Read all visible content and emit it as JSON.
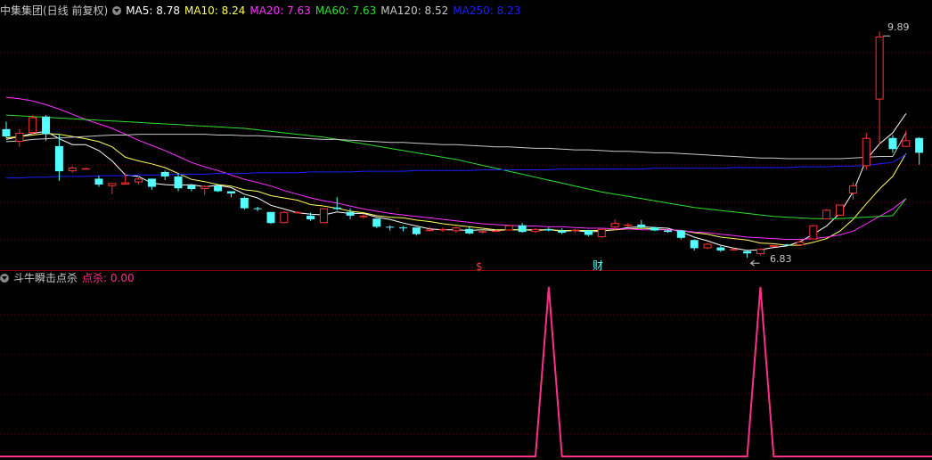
{
  "colors": {
    "background": "#000000",
    "up_candle": "#ff3232",
    "down_candle": "#54ffff",
    "grid": "#6e0000",
    "ma5": "#ffffff",
    "ma10": "#ffff5c",
    "ma20": "#ff32ff",
    "ma60": "#2ee02e",
    "ma120": "#c8c8c8",
    "ma250": "#1e1eff",
    "signal": "#ff2f8a"
  },
  "header": {
    "title": "中集集团(日线 前复权)",
    "indicators": [
      {
        "label": "MA5: 8.78",
        "color": "#ffffff"
      },
      {
        "label": "MA10: 8.24",
        "color": "#ffff5c"
      },
      {
        "label": "MA20: 7.63",
        "color": "#ff32ff"
      },
      {
        "label": "MA60: 7.63",
        "color": "#2ee02e"
      },
      {
        "label": "MA120: 8.52",
        "color": "#c8c8c8"
      },
      {
        "label": "MA250: 8.23",
        "color": "#1e1eff"
      }
    ]
  },
  "price_labels": {
    "high": "9.89",
    "low": "6.83"
  },
  "markers": {
    "dollar": "$",
    "caibao": "财"
  },
  "sub_chart": {
    "title": "斗牛瞬击点杀",
    "value_label": "点杀: 0.00"
  },
  "chart_data": {
    "type": "candlestick",
    "candles": [
      {
        "o": 8.57,
        "h": 8.67,
        "l": 8.45,
        "c": 8.47
      },
      {
        "o": 8.4,
        "h": 8.57,
        "l": 8.33,
        "c": 8.52
      },
      {
        "o": 8.52,
        "h": 8.76,
        "l": 8.5,
        "c": 8.73
      },
      {
        "o": 8.74,
        "h": 8.76,
        "l": 8.41,
        "c": 8.5
      },
      {
        "o": 8.34,
        "h": 8.5,
        "l": 7.87,
        "c": 8.0
      },
      {
        "o": 8.0,
        "h": 8.07,
        "l": 7.98,
        "c": 8.05
      },
      {
        "o": 8.03,
        "h": 8.05,
        "l": 8.03,
        "c": 8.04
      },
      {
        "o": 7.9,
        "h": 7.94,
        "l": 7.79,
        "c": 7.82
      },
      {
        "o": 7.8,
        "h": 7.84,
        "l": 7.69,
        "c": 7.84
      },
      {
        "o": 7.82,
        "h": 7.96,
        "l": 7.82,
        "c": 7.85
      },
      {
        "o": 7.85,
        "h": 7.94,
        "l": 7.82,
        "c": 7.9
      },
      {
        "o": 7.9,
        "h": 7.9,
        "l": 7.75,
        "c": 7.79
      },
      {
        "o": 7.99,
        "h": 8.01,
        "l": 7.88,
        "c": 7.93
      },
      {
        "o": 7.93,
        "h": 7.98,
        "l": 7.73,
        "c": 7.77
      },
      {
        "o": 7.81,
        "h": 7.82,
        "l": 7.73,
        "c": 7.76
      },
      {
        "o": 7.76,
        "h": 7.81,
        "l": 7.68,
        "c": 7.8
      },
      {
        "o": 7.8,
        "h": 7.82,
        "l": 7.72,
        "c": 7.73
      },
      {
        "o": 7.73,
        "h": 7.73,
        "l": 7.65,
        "c": 7.7
      },
      {
        "o": 7.64,
        "h": 7.66,
        "l": 7.48,
        "c": 7.5
      },
      {
        "o": 7.5,
        "h": 7.52,
        "l": 7.46,
        "c": 7.49
      },
      {
        "o": 7.45,
        "h": 7.45,
        "l": 7.29,
        "c": 7.3
      },
      {
        "o": 7.3,
        "h": 7.46,
        "l": 7.3,
        "c": 7.45
      },
      {
        "o": 7.44,
        "h": 7.46,
        "l": 7.43,
        "c": 7.45
      },
      {
        "o": 7.4,
        "h": 7.44,
        "l": 7.33,
        "c": 7.35
      },
      {
        "o": 7.3,
        "h": 7.5,
        "l": 7.3,
        "c": 7.5
      },
      {
        "o": 7.51,
        "h": 7.65,
        "l": 7.47,
        "c": 7.49
      },
      {
        "o": 7.45,
        "h": 7.5,
        "l": 7.35,
        "c": 7.4
      },
      {
        "o": 7.38,
        "h": 7.43,
        "l": 7.36,
        "c": 7.4
      },
      {
        "o": 7.36,
        "h": 7.36,
        "l": 7.23,
        "c": 7.25
      },
      {
        "o": 7.25,
        "h": 7.27,
        "l": 7.2,
        "c": 7.24
      },
      {
        "o": 7.24,
        "h": 7.26,
        "l": 7.19,
        "c": 7.23
      },
      {
        "o": 7.24,
        "h": 7.24,
        "l": 7.13,
        "c": 7.15
      },
      {
        "o": 7.2,
        "h": 7.25,
        "l": 7.19,
        "c": 7.21
      },
      {
        "o": 7.2,
        "h": 7.24,
        "l": 7.18,
        "c": 7.22
      },
      {
        "o": 7.19,
        "h": 7.25,
        "l": 7.17,
        "c": 7.24
      },
      {
        "o": 7.22,
        "h": 7.25,
        "l": 7.15,
        "c": 7.16
      },
      {
        "o": 7.18,
        "h": 7.21,
        "l": 7.16,
        "c": 7.19
      },
      {
        "o": 7.19,
        "h": 7.21,
        "l": 7.18,
        "c": 7.2
      },
      {
        "o": 7.2,
        "h": 7.27,
        "l": 7.2,
        "c": 7.27
      },
      {
        "o": 7.27,
        "h": 7.3,
        "l": 7.17,
        "c": 7.18
      },
      {
        "o": 7.18,
        "h": 7.23,
        "l": 7.17,
        "c": 7.22
      },
      {
        "o": 7.22,
        "h": 7.24,
        "l": 7.19,
        "c": 7.2
      },
      {
        "o": 7.2,
        "h": 7.23,
        "l": 7.15,
        "c": 7.17
      },
      {
        "o": 7.19,
        "h": 7.22,
        "l": 7.17,
        "c": 7.21
      },
      {
        "o": 7.2,
        "h": 7.21,
        "l": 7.12,
        "c": 7.14
      },
      {
        "o": 7.11,
        "h": 7.22,
        "l": 7.1,
        "c": 7.22
      },
      {
        "o": 7.24,
        "h": 7.35,
        "l": 7.2,
        "c": 7.3
      },
      {
        "o": 7.28,
        "h": 7.3,
        "l": 7.25,
        "c": 7.28
      },
      {
        "o": 7.28,
        "h": 7.34,
        "l": 7.22,
        "c": 7.24
      },
      {
        "o": 7.24,
        "h": 7.25,
        "l": 7.19,
        "c": 7.2
      },
      {
        "o": 7.2,
        "h": 7.22,
        "l": 7.17,
        "c": 7.18
      },
      {
        "o": 7.2,
        "h": 7.21,
        "l": 7.08,
        "c": 7.1
      },
      {
        "o": 7.07,
        "h": 7.08,
        "l": 6.93,
        "c": 6.96
      },
      {
        "o": 6.96,
        "h": 7.03,
        "l": 6.95,
        "c": 7.02
      },
      {
        "o": 6.97,
        "h": 6.99,
        "l": 6.91,
        "c": 6.93
      },
      {
        "o": 6.94,
        "h": 6.96,
        "l": 6.93,
        "c": 6.95
      },
      {
        "o": 6.92,
        "h": 6.93,
        "l": 6.83,
        "c": 6.89
      },
      {
        "o": 6.88,
        "h": 6.96,
        "l": 6.86,
        "c": 6.95
      },
      {
        "o": 6.98,
        "h": 7.0,
        "l": 6.98,
        "c": 7.0
      },
      {
        "o": 7.01,
        "h": 7.02,
        "l": 6.99,
        "c": 7.0
      },
      {
        "o": 7.0,
        "h": 7.06,
        "l": 7.0,
        "c": 7.05
      },
      {
        "o": 7.08,
        "h": 7.27,
        "l": 7.08,
        "c": 7.27
      },
      {
        "o": 7.35,
        "h": 7.49,
        "l": 7.35,
        "c": 7.48
      },
      {
        "o": 7.4,
        "h": 7.55,
        "l": 7.4,
        "c": 7.55
      },
      {
        "o": 7.7,
        "h": 7.85,
        "l": 7.62,
        "c": 7.81
      },
      {
        "o": 8.07,
        "h": 8.52,
        "l": 8.02,
        "c": 8.45
      },
      {
        "o": 8.97,
        "h": 9.89,
        "l": 8.36,
        "c": 9.82
      },
      {
        "o": 8.45,
        "h": 8.49,
        "l": 8.25,
        "c": 8.3
      },
      {
        "o": 8.33,
        "h": 8.55,
        "l": 8.33,
        "c": 8.42
      },
      {
        "o": 8.45,
        "h": 8.46,
        "l": 8.09,
        "c": 8.25
      }
    ],
    "moving_averages": [
      {
        "name": "MA5",
        "color": "#ffffff",
        "values": [
          8.43,
          8.47,
          8.51,
          8.54,
          8.44,
          8.36,
          8.36,
          8.28,
          8.14,
          7.95,
          7.93,
          7.84,
          7.82,
          7.81,
          7.82,
          7.79,
          7.81,
          7.78,
          7.69,
          7.64,
          7.54,
          7.49,
          7.44,
          7.42,
          7.41,
          7.45,
          7.43,
          7.43,
          7.38,
          7.35,
          7.3,
          7.26,
          7.22,
          7.21,
          7.21,
          7.2,
          7.21,
          7.2,
          7.21,
          7.21,
          7.21,
          7.21,
          7.19,
          7.2,
          7.18,
          7.19,
          7.21,
          7.24,
          7.25,
          7.24,
          7.23,
          7.18,
          7.11,
          7.06,
          7.0,
          6.96,
          6.93,
          6.94,
          6.97,
          6.99,
          7.05,
          7.15,
          7.26,
          7.43,
          7.72,
          8.16,
          8.37,
          8.52,
          8.78
        ]
      },
      {
        "name": "MA10",
        "color": "#ffff5c",
        "values": [
          8.45,
          8.47,
          8.49,
          8.51,
          8.5,
          8.47,
          8.44,
          8.4,
          8.33,
          8.19,
          8.14,
          8.1,
          8.05,
          7.97,
          7.89,
          7.86,
          7.82,
          7.8,
          7.75,
          7.73,
          7.67,
          7.64,
          7.61,
          7.55,
          7.53,
          7.5,
          7.46,
          7.44,
          7.4,
          7.38,
          7.37,
          7.34,
          7.32,
          7.29,
          7.27,
          7.25,
          7.23,
          7.21,
          7.21,
          7.21,
          7.2,
          7.21,
          7.2,
          7.2,
          7.2,
          7.2,
          7.21,
          7.22,
          7.23,
          7.22,
          7.21,
          7.2,
          7.17,
          7.15,
          7.11,
          7.09,
          7.07,
          7.03,
          7.02,
          7.0,
          7.0,
          7.04,
          7.09,
          7.19,
          7.35,
          7.56,
          7.76,
          7.93,
          8.24
        ]
      },
      {
        "name": "MA20",
        "color": "#ff32ff",
        "values": [
          9.0,
          8.98,
          8.95,
          8.9,
          8.84,
          8.77,
          8.7,
          8.64,
          8.58,
          8.5,
          8.42,
          8.35,
          8.28,
          8.2,
          8.12,
          8.06,
          8.01,
          7.95,
          7.89,
          7.85,
          7.8,
          7.74,
          7.69,
          7.64,
          7.6,
          7.57,
          7.53,
          7.49,
          7.46,
          7.43,
          7.41,
          7.39,
          7.37,
          7.35,
          7.33,
          7.31,
          7.29,
          7.28,
          7.27,
          7.26,
          7.26,
          7.25,
          7.25,
          7.24,
          7.23,
          7.23,
          7.22,
          7.22,
          7.21,
          7.21,
          7.21,
          7.2,
          7.18,
          7.17,
          7.15,
          7.13,
          7.11,
          7.1,
          7.09,
          7.08,
          7.08,
          7.09,
          7.11,
          7.14,
          7.19,
          7.29,
          7.39,
          7.49,
          7.63
        ]
      },
      {
        "name": "MA60",
        "color": "#2ee02e",
        "values": [
          8.76,
          8.75,
          8.74,
          8.73,
          8.72,
          8.71,
          8.7,
          8.69,
          8.68,
          8.67,
          8.66,
          8.65,
          8.64,
          8.63,
          8.62,
          8.61,
          8.6,
          8.59,
          8.58,
          8.56,
          8.54,
          8.52,
          8.5,
          8.48,
          8.46,
          8.43,
          8.4,
          8.37,
          8.34,
          8.31,
          8.28,
          8.25,
          8.22,
          8.19,
          8.16,
          8.12,
          8.08,
          8.04,
          8.0,
          7.96,
          7.92,
          7.88,
          7.84,
          7.8,
          7.76,
          7.72,
          7.69,
          7.66,
          7.63,
          7.6,
          7.57,
          7.54,
          7.51,
          7.49,
          7.47,
          7.45,
          7.43,
          7.41,
          7.39,
          7.38,
          7.37,
          7.36,
          7.36,
          7.36,
          7.37,
          7.38,
          7.39,
          7.4,
          7.63
        ]
      },
      {
        "name": "MA120",
        "color": "#c8c8c8",
        "values": [
          8.4,
          8.41,
          8.43,
          8.44,
          8.45,
          8.46,
          8.47,
          8.48,
          8.49,
          8.49,
          8.5,
          8.5,
          8.5,
          8.5,
          8.5,
          8.5,
          8.49,
          8.49,
          8.48,
          8.48,
          8.47,
          8.46,
          8.45,
          8.44,
          8.43,
          8.43,
          8.42,
          8.41,
          8.4,
          8.39,
          8.39,
          8.38,
          8.37,
          8.36,
          8.36,
          8.35,
          8.34,
          8.33,
          8.33,
          8.32,
          8.31,
          8.31,
          8.3,
          8.29,
          8.29,
          8.28,
          8.27,
          8.27,
          8.26,
          8.25,
          8.25,
          8.24,
          8.23,
          8.22,
          8.21,
          8.2,
          8.19,
          8.18,
          8.18,
          8.17,
          8.17,
          8.17,
          8.17,
          8.17,
          8.18,
          8.19,
          8.2,
          8.2,
          8.52
        ]
      },
      {
        "name": "MA250",
        "color": "#1e1eff",
        "values": [
          7.91,
          7.91,
          7.92,
          7.92,
          7.93,
          7.93,
          7.93,
          7.94,
          7.94,
          7.94,
          7.95,
          7.95,
          7.95,
          7.96,
          7.96,
          7.96,
          7.97,
          7.97,
          7.97,
          7.98,
          7.98,
          7.98,
          7.98,
          7.99,
          7.99,
          7.99,
          7.99,
          8.0,
          8.0,
          8.0,
          8.0,
          8.01,
          8.01,
          8.01,
          8.01,
          8.01,
          8.02,
          8.02,
          8.02,
          8.02,
          8.02,
          8.02,
          8.03,
          8.03,
          8.03,
          8.03,
          8.03,
          8.03,
          8.03,
          8.04,
          8.04,
          8.04,
          8.04,
          8.04,
          8.04,
          8.05,
          8.05,
          8.05,
          8.05,
          8.05,
          8.06,
          8.06,
          8.06,
          8.07,
          8.07,
          8.08,
          8.1,
          8.12,
          8.23
        ]
      }
    ],
    "signal_series": {
      "name": "点杀",
      "values": [
        0,
        0,
        0,
        0,
        0,
        0,
        0,
        0,
        0,
        0,
        0,
        0,
        0,
        0,
        0,
        0,
        0,
        0,
        0,
        0,
        0,
        0,
        0,
        0,
        0,
        0,
        0,
        0,
        0,
        0,
        0,
        0,
        0,
        0,
        0,
        0,
        0,
        0,
        0,
        0,
        0,
        1,
        0,
        0,
        0,
        0,
        0,
        0,
        0,
        0,
        0,
        0,
        0,
        0,
        0,
        0,
        0,
        1,
        0,
        0,
        0,
        0,
        0,
        0,
        0,
        0,
        0,
        0,
        0
      ]
    },
    "ylim": [
      6.7,
      10.05
    ]
  }
}
